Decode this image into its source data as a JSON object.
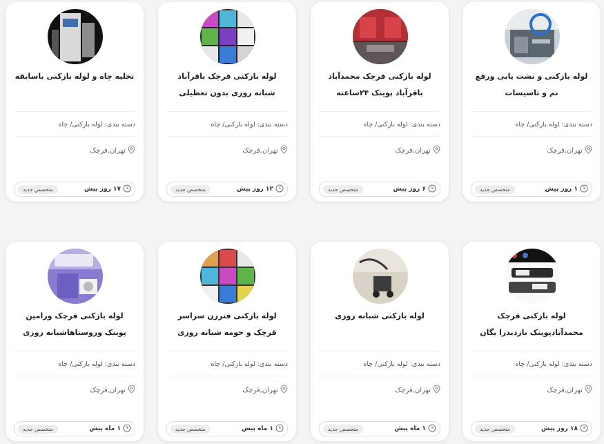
{
  "category_prefix": "دسته بندی:",
  "cards": [
    {
      "title": "لوله بازکنی و نشت یابی ورفع نم و تاسیسات",
      "category": "لوله بازکنی/ چاه",
      "location": "تهران,قرچک",
      "time": "۱ روز پیش",
      "badge": "متخصص جدید",
      "image": "plumbing-tools-photo"
    },
    {
      "title": "لوله بازکنی قرچک محمدآباد باقرآباد پوینک ۲۴ساعته",
      "category": "لوله بازکنی/ چاه",
      "location": "تهران,قرچک",
      "time": "۶ روز پیش",
      "badge": "متخصص جدید",
      "image": "red-lit-room-photo"
    },
    {
      "title": "لوله بازکنی قرچک باقرآباد شبانه روزی بدون تعطیلی",
      "category": "لوله بازکنی/ چاه",
      "location": "تهران,قرچک",
      "time": "۱۲ روز پیش",
      "badge": "متخصص جدید",
      "image": "colorful-collage-photo"
    },
    {
      "title": "تخلیه چاه و لوله بازکنی باسابقه",
      "category": "لوله بازکنی/ چاه",
      "location": "تهران,قرچک",
      "time": "۱۷ روز پیش",
      "badge": "متخصص جدید",
      "image": "machine-photo"
    },
    {
      "title": "لوله بازکنی قرچک محمدآبادپوینک بازدیدرا یگان",
      "category": "لوله بازکنی/ چاه",
      "location": "تهران,قرچک",
      "time": "۱۸ روز پیش",
      "badge": "متخصص جدید",
      "image": "equipment-labels-photo"
    },
    {
      "title": "لوله بازکنی شبانه روزی",
      "category": "لوله بازکنی/ چاه",
      "location": "تهران,قرچک",
      "time": "۱ ماه پیش",
      "badge": "متخصص جدید",
      "image": "floor-machine-photo"
    },
    {
      "title": "لوله بازکنی فنرزن سراسر قرچک و حومه شبانه روزی",
      "category": "لوله بازکنی/ چاه",
      "location": "تهران,قرچک",
      "time": "۱ ماه پیش",
      "badge": "متخصص جدید",
      "image": "colorful-collage-photo-2"
    },
    {
      "title": "لوله بازکنی قرچک ورامین پوینک وروستاهاشبانه روزی",
      "category": "لوله بازکنی/ چاه",
      "location": "تهران,قرچک",
      "time": "۱ ماه پیش",
      "badge": "متخصص جدید",
      "image": "purple-appliance-photo"
    }
  ]
}
